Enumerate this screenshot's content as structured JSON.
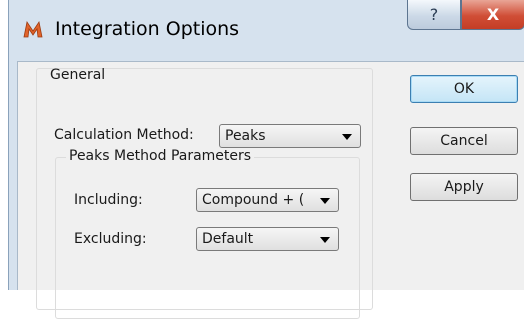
{
  "window": {
    "title": "Integration Options",
    "help_glyph": "?",
    "close_glyph": "X",
    "accent_color": "#d6e2ee",
    "close_color": "#c43d25",
    "app_icon": "m-logo-icon"
  },
  "general": {
    "legend": "General",
    "calc_method_label": "Calculation Method:",
    "calc_method_value": "Peaks",
    "peaks_group": {
      "legend": "Peaks Method Parameters",
      "including_label": "Including:",
      "including_value": "Compound + (",
      "excluding_label": "Excluding:",
      "excluding_value": "Default"
    }
  },
  "buttons": {
    "ok": "OK",
    "cancel": "Cancel",
    "apply": "Apply"
  }
}
